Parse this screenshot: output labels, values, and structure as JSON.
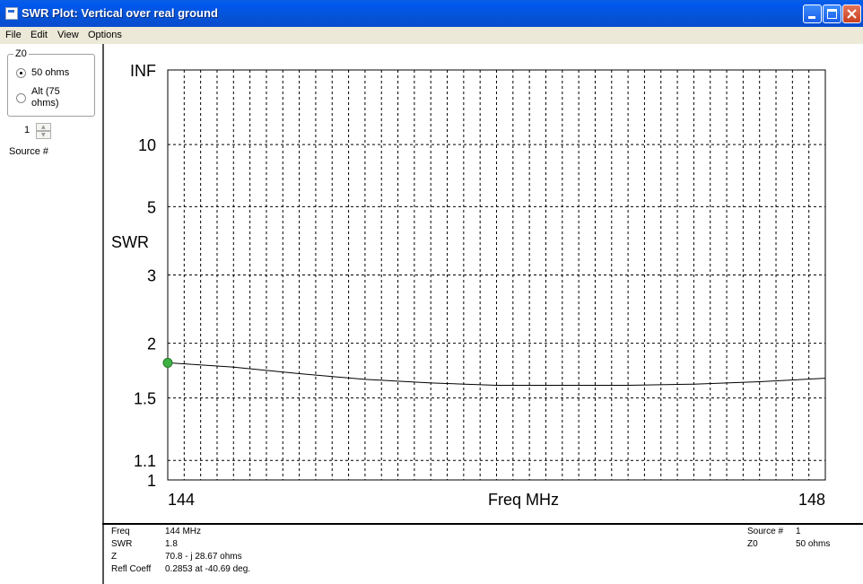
{
  "window": {
    "title": "SWR Plot: Vertical over real ground"
  },
  "menu": [
    "File",
    "Edit",
    "View",
    "Options"
  ],
  "sidebar": {
    "z0_group_label": "Z0",
    "option_50": "50 ohms",
    "option_alt_line1": "Alt (75",
    "option_alt_line2": "ohms)",
    "source_value": "1",
    "source_label": "Source #"
  },
  "chart_data": {
    "type": "line",
    "ylabel": "SWR",
    "xlabel": "Freq MHz",
    "x_start_label": "144",
    "x_end_label": "148",
    "x_range": [
      144,
      148
    ],
    "y_scale": "reflection-coefficient (SWR)",
    "y_tick_labels": [
      "INF",
      "10",
      "5",
      "3",
      "2",
      "1.5",
      "1.1",
      "1"
    ],
    "grid": true,
    "series": [
      {
        "x": [
          144.0,
          144.4,
          144.8,
          145.2,
          145.6,
          146.0,
          146.4,
          146.8,
          147.2,
          147.6,
          148.0
        ],
        "values": [
          1.8,
          1.76,
          1.7,
          1.65,
          1.62,
          1.6,
          1.6,
          1.6,
          1.61,
          1.63,
          1.66
        ]
      }
    ],
    "marker": {
      "x": 144,
      "y": 1.8,
      "color": "#3cb043"
    }
  },
  "status": {
    "freq_label": "Freq",
    "freq_value": "144 MHz",
    "swr_label": "SWR",
    "swr_value": "1.8",
    "z_label": "Z",
    "z_value": "70.8 - j 28.67 ohms",
    "refl_label": "Refl Coeff",
    "refl_value": "0.2853 at -40.69 deg.",
    "source_label": "Source #",
    "source_value": "1",
    "z0_label": "Z0",
    "z0_value": "50 ohms"
  }
}
